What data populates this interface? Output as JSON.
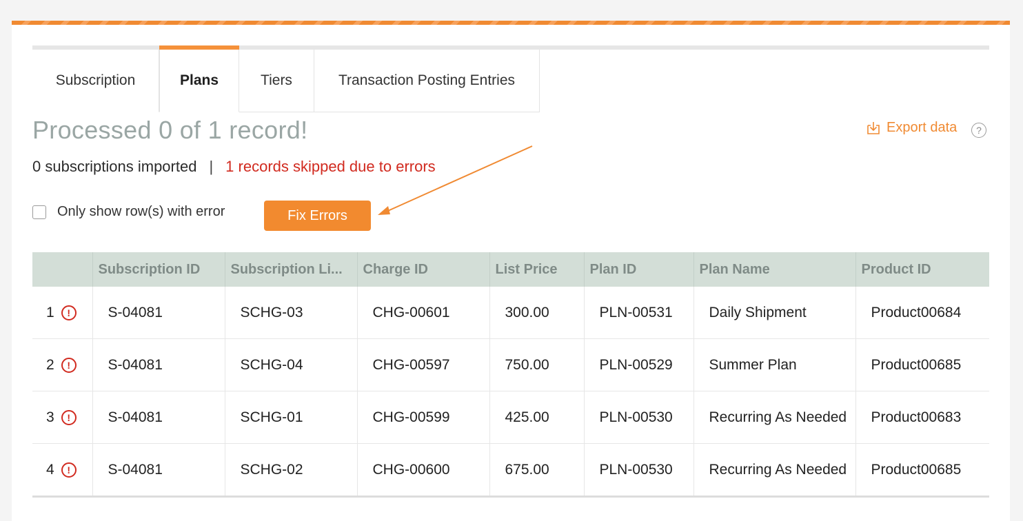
{
  "tabs": [
    {
      "label": "Subscription"
    },
    {
      "label": "Plans"
    },
    {
      "label": "Tiers"
    },
    {
      "label": "Transaction Posting Entries"
    }
  ],
  "status": {
    "title": "Processed 0 of 1 record!",
    "imported": "0 subscriptions imported",
    "separator": "|",
    "skipped": "1 records skipped due to errors"
  },
  "export": {
    "label": "Export data",
    "icon": "download-icon",
    "help": "?"
  },
  "filter": {
    "label": "Only show row(s) with error",
    "checked": false
  },
  "fix_button": {
    "label": "Fix Errors"
  },
  "colors": {
    "accent": "#f28a2f",
    "error": "#d12a1f",
    "header_bg": "#d3ded7"
  },
  "table": {
    "columns": [
      "",
      "Subscription ID",
      "Subscription Li...",
      "Charge ID",
      "List Price",
      "Plan ID",
      "Plan Name",
      "Product ID"
    ],
    "rows": [
      {
        "index": "1",
        "error": "!",
        "cells": [
          "S-04081",
          "SCHG-03",
          "CHG-00601",
          "300.00",
          "PLN-00531",
          "Daily Shipment",
          "Product00684"
        ]
      },
      {
        "index": "2",
        "error": "!",
        "cells": [
          "S-04081",
          "SCHG-04",
          "CHG-00597",
          "750.00",
          "PLN-00529",
          "Summer Plan",
          "Product00685"
        ]
      },
      {
        "index": "3",
        "error": "!",
        "cells": [
          "S-04081",
          "SCHG-01",
          "CHG-00599",
          "425.00",
          "PLN-00530",
          "Recurring As Needed",
          "Product00683"
        ]
      },
      {
        "index": "4",
        "error": "!",
        "cells": [
          "S-04081",
          "SCHG-02",
          "CHG-00600",
          "675.00",
          "PLN-00530",
          "Recurring As Needed",
          "Product00685"
        ]
      }
    ]
  }
}
